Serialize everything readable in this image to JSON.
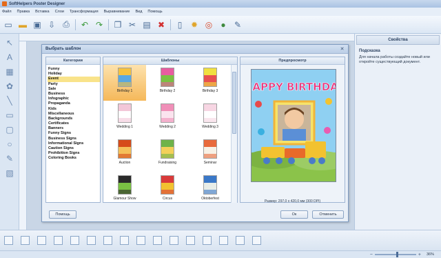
{
  "app": {
    "title": "SoftHelpers Poster Designer"
  },
  "menu": [
    "Файл",
    "Правка",
    "Вставка",
    "Слои",
    "Трансформация",
    "Выравнивание",
    "Вид",
    "Помощь"
  ],
  "toolbar": [
    "new-icon",
    "open-icon",
    "save-icon",
    "export-icon",
    "print-icon",
    "undo-icon",
    "redo-icon",
    "copy-icon",
    "cut-icon",
    "paste-icon",
    "delete-icon",
    "page-icon",
    "settings-icon",
    "help-icon",
    "web-icon",
    "tools-icon"
  ],
  "right_panel": {
    "header": "Свойства",
    "hint_title": "Подсказка",
    "hint_text": "Для начала работы создайте новый или откройте существующий документ."
  },
  "dialog": {
    "title": "Выбрать шаблон",
    "categories_header": "Категории",
    "templates_header": "Шаблоны",
    "preview_header": "Предпросмотр",
    "categories": [
      "Funny",
      "Holiday",
      "Event",
      "Party",
      "Sale",
      "Business",
      "Infographic",
      "Propaganda",
      "Kids",
      "Miscellaneous",
      "Backgrounds",
      "Certificates",
      "Banners",
      "Funny Signs",
      "Business Signs",
      "Informational Signs",
      "Caution Signs",
      "Prohibition Signs",
      "Coloring Books"
    ],
    "selected_category": "Event",
    "templates": [
      {
        "label": "Birthday 1",
        "selected": true,
        "c1": "#f6c23e",
        "c2": "#5aa8e0"
      },
      {
        "label": "Birthday 2",
        "selected": false,
        "c1": "#e85ca0",
        "c2": "#7ac143"
      },
      {
        "label": "Birthday 3",
        "selected": false,
        "c1": "#f0e040",
        "c2": "#e85050"
      },
      {
        "label": "Wedding 1",
        "selected": false,
        "c1": "#f3c7d8",
        "c2": "#ffffff"
      },
      {
        "label": "Wedding 2",
        "selected": false,
        "c1": "#f08fb8",
        "c2": "#fbe3ee"
      },
      {
        "label": "Wedding 3",
        "selected": false,
        "c1": "#f7d6e3",
        "c2": "#ffffff"
      },
      {
        "label": "Auction",
        "selected": false,
        "c1": "#d64b1a",
        "c2": "#f5c05a"
      },
      {
        "label": "Fundraising",
        "selected": false,
        "c1": "#6fb34a",
        "c2": "#f4d05a"
      },
      {
        "label": "Seminar",
        "selected": false,
        "c1": "#e86a3c",
        "c2": "#f7f1e6"
      },
      {
        "label": "Glamour Show",
        "selected": false,
        "c1": "#2a2a2a",
        "c2": "#7ac143"
      },
      {
        "label": "Circus",
        "selected": false,
        "c1": "#d93a3a",
        "c2": "#f2c230"
      },
      {
        "label": "Oktoberfest",
        "selected": false,
        "c1": "#3a78c8",
        "c2": "#e8ede8"
      }
    ],
    "preview_size": "Размер: 297,0 x 420,0 мм (300 DPI)",
    "poster_text": "HAPPY BIRTHDAY",
    "buttons": {
      "help": "Помощь",
      "ok": "Ок",
      "cancel": "Отменить"
    }
  },
  "status": {
    "zoom": "36%",
    "zoom_fraction": 0.55
  }
}
